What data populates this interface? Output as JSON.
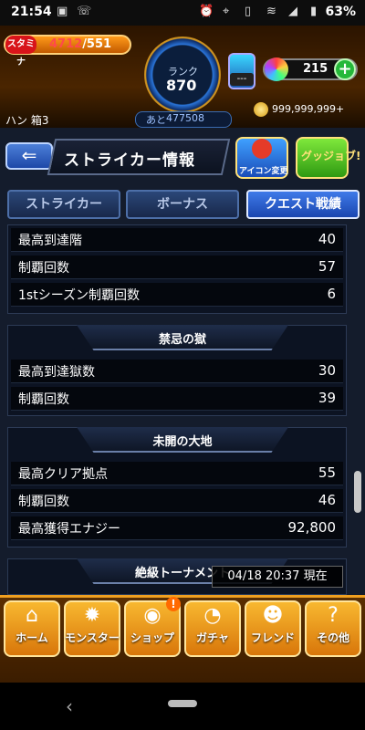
{
  "status_bar": {
    "time": "21:54",
    "battery": "63%"
  },
  "header": {
    "stamina_label": "スタミナ",
    "stamina_current": "4712",
    "stamina_max": "/551",
    "rank_label": "ランク",
    "rank_value": "870",
    "exp_label": "あと",
    "exp_value": "477508",
    "luck_dash": "---",
    "orbs": "215",
    "gold": "999,999,999+",
    "player_name": "ハン 箱3"
  },
  "page": {
    "title": "ストライカー情報",
    "icon_btn_1_label": "アイコン変更",
    "icon_btn_2_label": "グッジョブ!"
  },
  "tabs": [
    {
      "label": "ストライカー",
      "active": false
    },
    {
      "label": "ボーナス",
      "active": false
    },
    {
      "label": "クエスト戦績",
      "active": true
    }
  ],
  "section_top": {
    "rows": [
      {
        "label": "最高到達階",
        "value": "40"
      },
      {
        "label": "制覇回数",
        "value": "57"
      },
      {
        "label": "1stシーズン制覇回数",
        "value": "6"
      }
    ]
  },
  "section_kinki": {
    "title": "禁忌の獄",
    "rows": [
      {
        "label": "最高到達獄数",
        "value": "30"
      },
      {
        "label": "制覇回数",
        "value": "39"
      }
    ]
  },
  "section_mikai": {
    "title": "未開の大地",
    "rows": [
      {
        "label": "最高クリア拠点",
        "value": "55"
      },
      {
        "label": "制覇回数",
        "value": "46"
      },
      {
        "label": "最高獲得エナジー",
        "value": "92,800"
      }
    ]
  },
  "section_tournament": {
    "title": "絶級トーナメント"
  },
  "timestamp": "04/18 20:37 現在",
  "bottom_nav": [
    {
      "label": "ホーム",
      "icon": "home-icon"
    },
    {
      "label": "モンスター",
      "icon": "monster-icon"
    },
    {
      "label": "ショップ",
      "icon": "shop-orb-icon"
    },
    {
      "label": "ガチャ",
      "icon": "gacha-icon"
    },
    {
      "label": "フレンド",
      "icon": "friend-icon"
    },
    {
      "label": "その他",
      "icon": "other-icon"
    }
  ],
  "shop_badge": "!"
}
